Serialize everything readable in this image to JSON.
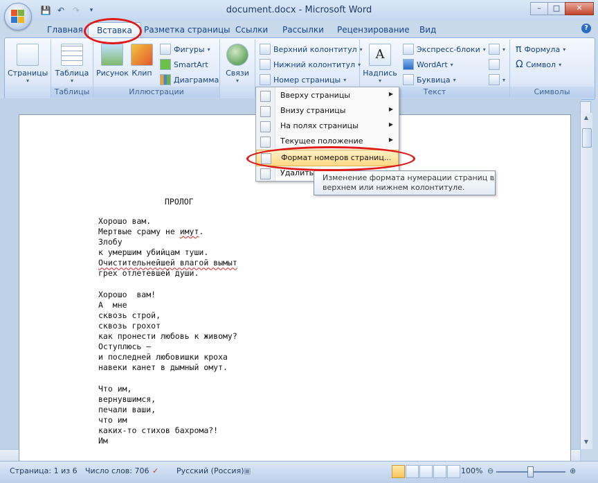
{
  "window": {
    "title": "document.docx - Microsoft Word",
    "controls": {
      "minimize": "–",
      "maximize": "□",
      "close": "✕"
    }
  },
  "qat": {
    "save_icon": "save-icon",
    "undo_icon": "undo-icon",
    "redo_icon": "redo-icon",
    "customize_icon": "customize-icon"
  },
  "tabs": [
    "Главная",
    "Вставка",
    "Разметка страницы",
    "Ссылки",
    "Рассылки",
    "Рецензирование",
    "Вид"
  ],
  "active_tab": "Вставка",
  "ribbon": {
    "groups": {
      "pages": {
        "label": "",
        "button": "Страницы"
      },
      "tables": {
        "label": "Таблицы",
        "button": "Таблица"
      },
      "illustrations": {
        "label": "Иллюстрации",
        "picture": "Рисунок",
        "clip": "Клип",
        "shapes": "Фигуры",
        "smartart": "SmartArt",
        "chart": "Диаграмма"
      },
      "links": {
        "label": "",
        "button": "Связи"
      },
      "header_footer": {
        "header": "Верхний колонтитул",
        "footer": "Нижний колонтитул",
        "page_number": "Номер страницы"
      },
      "text": {
        "label": "Текст",
        "textbox": "Надпись",
        "quickparts": "Экспресс-блоки",
        "wordart": "WordArt",
        "dropcap": "Буквица"
      },
      "symbols": {
        "label": "Символы",
        "formula": "Формула",
        "symbol": "Символ"
      }
    }
  },
  "page_number_menu": {
    "items": [
      "Вверху страницы",
      "Внизу страницы",
      "На полях страницы",
      "Текущее положение",
      "Формат номеров страниц...",
      "Удалить н"
    ],
    "highlighted": "Формат номеров страниц..."
  },
  "tooltip": {
    "line1": "Изменение формата нумерации страниц в",
    "line2": "верхнем или нижнем колонтитуле."
  },
  "document": {
    "heading": "ПРОЛОГ",
    "lines": [
      "Хорошо вам.",
      "Мертвые сраму не имут.",
      "Злобу",
      "к умершим убийцам туши.",
      "Очистительнейшей влагой вымыт",
      "грех отлетевшей души.",
      "",
      "Хорошо  вам!",
      "А  мне",
      "сквозь строй,",
      "сквозь грохот",
      "как пронести любовь к живому?",
      "Оступлюсь –",
      "и последней любовишки кроха",
      "навеки канет в дымный омут.",
      "",
      "Что им,",
      "вернувшимся,",
      "печали ваши,",
      "что им",
      "каких-то стихов бахрома?!",
      "Им"
    ]
  },
  "status": {
    "page": "Страница: 1 из 6",
    "words": "Число слов: 706",
    "language": "Русский (Россия)",
    "zoom": "100%",
    "zoom_level_percent": 100
  }
}
